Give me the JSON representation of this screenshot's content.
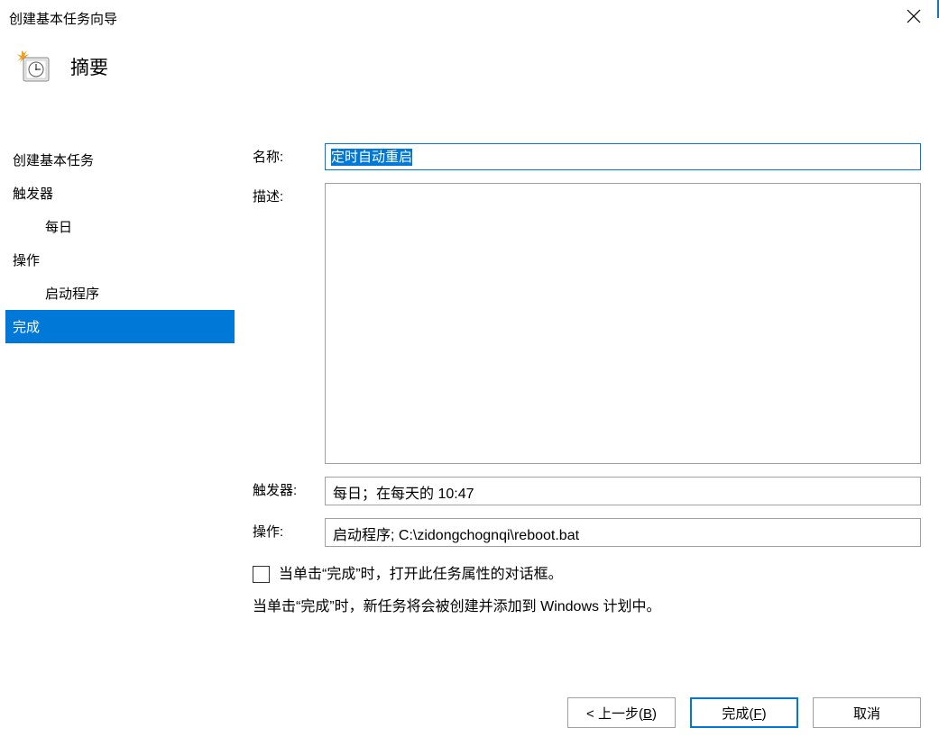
{
  "window": {
    "title": "创建基本任务向导"
  },
  "header": {
    "title": "摘要"
  },
  "sidebar": {
    "items": [
      {
        "label": "创建基本任务",
        "sub": false,
        "active": false
      },
      {
        "label": "触发器",
        "sub": false,
        "active": false
      },
      {
        "label": "每日",
        "sub": true,
        "active": false
      },
      {
        "label": "操作",
        "sub": false,
        "active": false
      },
      {
        "label": "启动程序",
        "sub": true,
        "active": false
      },
      {
        "label": "完成",
        "sub": false,
        "active": true
      }
    ]
  },
  "panel": {
    "name_label": "名称:",
    "name_value": "定时自动重启",
    "desc_label": "描述:",
    "desc_value": "",
    "trigger_label": "触发器:",
    "trigger_value": "每日；在每天的 10:47",
    "action_label": "操作:",
    "action_value": "启动程序; C:\\zidongchognqi\\reboot.bat",
    "checkbox_label": "当单击“完成”时，打开此任务属性的对话框。",
    "info_text": "当单击“完成”时，新任务将会被创建并添加到 Windows 计划中。"
  },
  "buttons": {
    "back": "< 上一步(B)",
    "back_key": "B",
    "finish": "完成(F)",
    "finish_key": "F",
    "cancel": "取消"
  }
}
